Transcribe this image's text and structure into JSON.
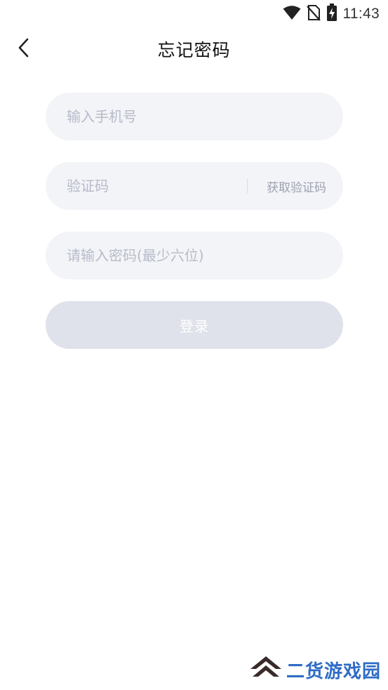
{
  "status_bar": {
    "time": "11:43",
    "icons": [
      "wifi-icon",
      "no-sim-icon",
      "battery-charging-icon"
    ]
  },
  "header": {
    "title": "忘记密码",
    "back_icon": "chevron-left-icon"
  },
  "form": {
    "phone_placeholder": "输入手机号",
    "code_placeholder": "验证码",
    "get_code_label": "获取验证码",
    "password_placeholder": "请输入密码(最少六位)",
    "submit_label": "登录"
  },
  "colors": {
    "field_bg": "#f3f4f8",
    "button_disabled_bg": "#dfe2ea",
    "placeholder": "#b7bbc8",
    "watermark_blue": "#2f6cc6",
    "watermark_logo": "#3a2a2a"
  },
  "watermark": {
    "text": "二货游戏园",
    "logo_icon": "double-chevron-up-logo-icon"
  }
}
